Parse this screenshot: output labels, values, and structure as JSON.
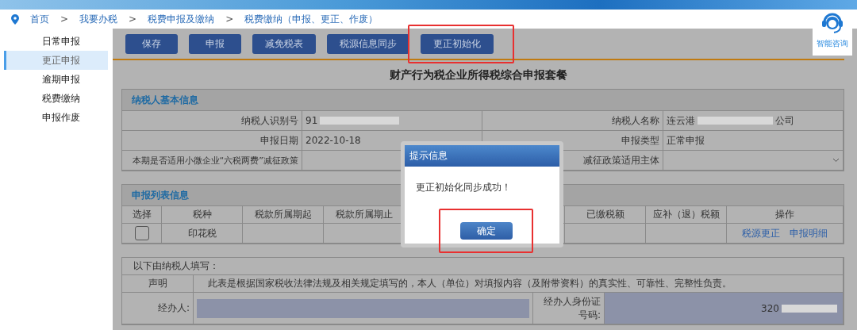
{
  "breadcrumb": [
    "首页",
    "我要办税",
    "税费申报及缴纳",
    "税费缴纳（申报、更正、作废）"
  ],
  "breadcrumb_separator": ">",
  "help": {
    "label": "智能咨询"
  },
  "sidebar": {
    "items": [
      {
        "label": "日常申报",
        "selected": false
      },
      {
        "label": "更正申报",
        "selected": true
      },
      {
        "label": "逾期申报",
        "selected": false
      },
      {
        "label": "税费缴纳",
        "selected": false
      },
      {
        "label": "申报作废",
        "selected": false
      }
    ]
  },
  "toolbar": {
    "buttons": [
      {
        "label": "保存",
        "highlighted": false
      },
      {
        "label": "申报",
        "highlighted": false
      },
      {
        "label": "减免税表",
        "highlighted": false
      },
      {
        "label": "税源信息同步",
        "highlighted": false
      },
      {
        "label": "更正初始化",
        "highlighted": true
      }
    ]
  },
  "form_title": "财产行为税企业所得税综合申报套餐",
  "taxpayer_info": {
    "title": "纳税人基本信息",
    "rows": [
      {
        "label_1": "纳税人识别号",
        "value_1": "91",
        "redacted_1": true,
        "label_2": "纳税人名称",
        "value_2": "连云港",
        "value_2_suffix": "公司",
        "redacted_2": true
      },
      {
        "label_1": "申报日期",
        "value_1": "2022-10-18",
        "label_2": "申报类型",
        "value_2": "正常申报"
      },
      {
        "label_1": "本期是否适用小微企业“六税两费”减征政策",
        "label_2": "减征政策适用主体",
        "kind": "select"
      }
    ]
  },
  "declaration_list": {
    "title": "申报列表信息",
    "columns": [
      "选择",
      "税种",
      "税款所属期起",
      "税款所属期止",
      "已缴税额",
      "应补（退）税额",
      "操作"
    ],
    "rows": [
      {
        "checked": false,
        "tax": "印花税",
        "actions": [
          "税源更正",
          "申报明细"
        ]
      }
    ]
  },
  "filler": {
    "title": "以下由纳税人填写：",
    "statement_label": "声明",
    "statement": "此表是根据国家税收法律法规及相关规定填写的，本人（单位）对填报内容（及附带资料）的真实性、可靠性、完整性负责。",
    "agent_label": "经办人:",
    "agent_id_label": "经办人身份证号码:",
    "agent_id_value": "320"
  },
  "dialog": {
    "title": "提示信息",
    "message": "更正初始化同步成功！",
    "button": "确定",
    "button_highlighted": true
  }
}
